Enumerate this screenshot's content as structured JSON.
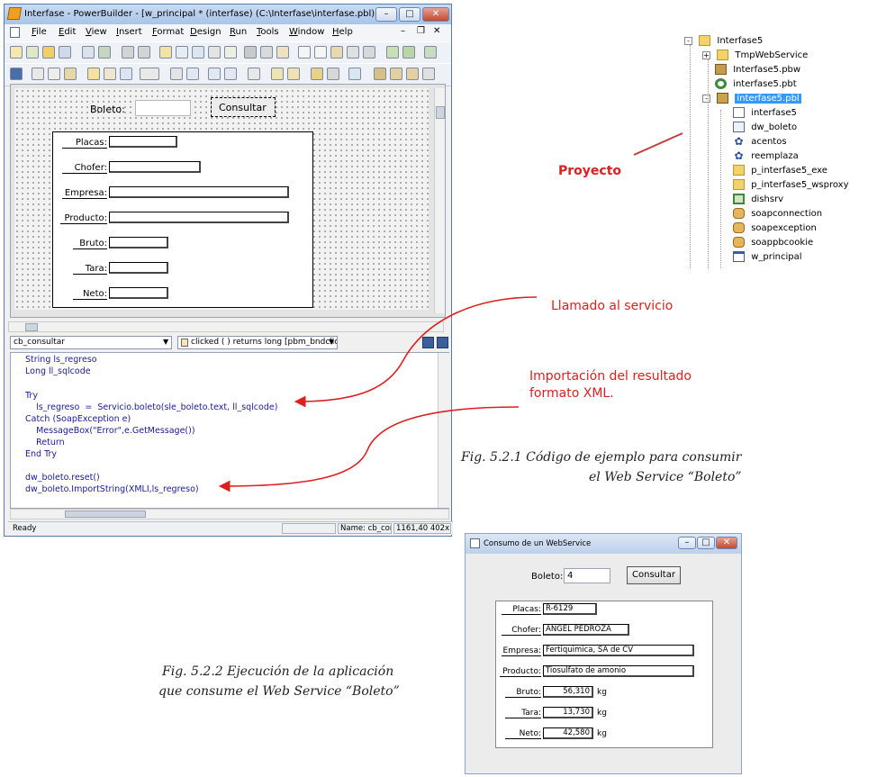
{
  "pb_window": {
    "title": "Interfase - PowerBuilder - [w_principal * (interfase) (C:\\Interfase\\interfase.pbl) inherited...",
    "menu": [
      "File",
      "Edit",
      "View",
      "Insert",
      "Format",
      "Design",
      "Run",
      "Tools",
      "Window",
      "Help"
    ],
    "boleto_label": "Boleto:",
    "consultar_label": "Consultar",
    "fields": [
      {
        "label": "Placas:"
      },
      {
        "label": "Chofer:"
      },
      {
        "label": "Empresa:"
      },
      {
        "label": "Producto:"
      },
      {
        "label": "Bruto:"
      },
      {
        "label": "Tara:"
      },
      {
        "label": "Neto:"
      }
    ],
    "object_dropdown": "cb_consultar",
    "event_dropdown": "clicked ( ) returns long [pbm_bndclicke",
    "code_lines": [
      "String ls_regreso",
      "Long ll_sqlcode",
      "",
      "Try",
      "    ls_regreso  =  Servicio.boleto(sle_boleto.text, ll_sqlcode)",
      "Catch (SoapException e)",
      "    MessageBox(\"Error\",e.GetMessage())",
      "    Return",
      "End Try",
      "",
      "dw_boleto.reset()",
      "dw_boleto.ImportString(XMLI,ls_regreso)"
    ],
    "status": {
      "ready": "Ready",
      "name": "Name: cb_con",
      "coords": "1161,40 402x"
    }
  },
  "tree": {
    "items": [
      {
        "label": "Interfase5",
        "icon": "folder-open-icon"
      },
      {
        "label": "TmpWebService",
        "icon": "folder-icon"
      },
      {
        "label": "Interfase5.pbw",
        "icon": "workspace-icon"
      },
      {
        "label": "interfase5.pbt",
        "icon": "target-icon"
      },
      {
        "label": "interfase5.pbl",
        "icon": "library-icon",
        "selected": true
      },
      {
        "label": "interfase5",
        "icon": "application-icon"
      },
      {
        "label": "dw_boleto",
        "icon": "datawindow-icon"
      },
      {
        "label": "acentos",
        "icon": "function-icon"
      },
      {
        "label": "reemplaza",
        "icon": "function-icon"
      },
      {
        "label": "p_interfase5_exe",
        "icon": "project-icon"
      },
      {
        "label": "p_interfase5_wsproxy",
        "icon": "project-icon"
      },
      {
        "label": "dishsrv",
        "icon": "proxy-icon"
      },
      {
        "label": "soapconnection",
        "icon": "userobject-icon"
      },
      {
        "label": "soapexception",
        "icon": "userobject-icon"
      },
      {
        "label": "soappbcookie",
        "icon": "userobject-icon"
      },
      {
        "label": "w_principal",
        "icon": "window-icon"
      }
    ]
  },
  "annotations": {
    "proyecto": "Proyecto",
    "llamado": "Llamado al servicio",
    "importacion_line1": "Importación del resultado",
    "importacion_line2": "formato XML."
  },
  "captions": {
    "fig1_line1": "Fig. 5.2.1 Código de ejemplo para consumir",
    "fig1_line2": "el Web Service “Boleto”",
    "fig2_line1": "Fig. 5.2.2 Ejecución de la aplicación",
    "fig2_line2": "que consume el Web Service “Boleto”"
  },
  "runtime_dialog": {
    "title": "Consumo de un WebService",
    "boleto_label": "Boleto:",
    "boleto_value": "4",
    "consultar_label": "Consultar",
    "rows": [
      {
        "label": "Placas:",
        "value": "R-6129",
        "unit": ""
      },
      {
        "label": "Chofer:",
        "value": "ANGEL PEDROZA",
        "unit": ""
      },
      {
        "label": "Empresa:",
        "value": "Fertiquimica, SA de CV",
        "unit": ""
      },
      {
        "label": "Producto:",
        "value": "Tiosulfato de amonio",
        "unit": ""
      },
      {
        "label": "Bruto:",
        "value": "56,310",
        "unit": "kg"
      },
      {
        "label": "Tara:",
        "value": "13,730",
        "unit": "kg"
      },
      {
        "label": "Neto:",
        "value": "42,580",
        "unit": "kg"
      }
    ]
  },
  "colors": {
    "annotation_red": "#dd1f1f",
    "selection_blue": "#3399ff"
  }
}
